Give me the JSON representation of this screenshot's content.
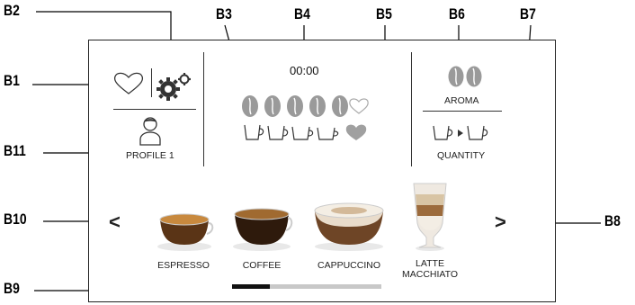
{
  "callouts": {
    "b1": "B1",
    "b2": "B2",
    "b3": "B3",
    "b4": "B4",
    "b5": "B5",
    "b6": "B6",
    "b7": "B7",
    "b8": "B8",
    "b9": "B9",
    "b10": "B10",
    "b11": "B11"
  },
  "panel": {
    "clock": "00:00",
    "profile_label": "PROFILE 1",
    "aroma_label": "AROMA",
    "quantity_label": "QUANTITY",
    "aroma_level_beans": 5,
    "quantity_level_cups": 4,
    "prev_arrow": "<",
    "next_arrow": ">"
  },
  "drinks": [
    {
      "label": "ESPRESSO"
    },
    {
      "label": "COFFEE"
    },
    {
      "label": "CAPPUCCINO"
    },
    {
      "label": "LATTE MACCHIATO",
      "label_line1": "LATTE",
      "label_line2": "MACCHIATO"
    }
  ],
  "page_indicator": {
    "active_page": 1,
    "total_pages": 4
  },
  "colors": {
    "bean": "#9a9a9a",
    "heart_filled": "#a0a0a0",
    "progress_active": "#111111",
    "progress_track": "#c8c8c8"
  }
}
